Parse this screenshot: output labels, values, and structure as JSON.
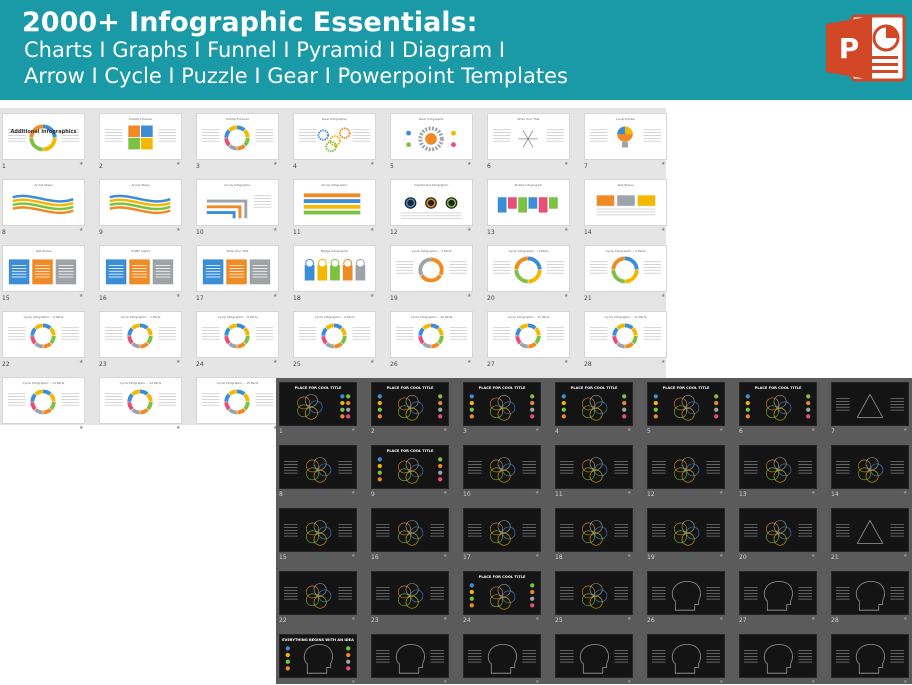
{
  "header": {
    "title": "2000+ Infographic Essentials:",
    "subtitle_line1": "Charts I Graphs I Funnel I Pyramid I Diagram I",
    "subtitle_line2": "Arrow I Cycle I Puzzle I Gear I Powerpoint Templates",
    "logo_icon": "powerpoint-logo-icon",
    "logo_letter": "P"
  },
  "colors": {
    "banner": "#1a9aa6",
    "powerpoint_orange": "#d24726",
    "light_panel": "#e5e5e5",
    "dark_panel": "#5b5b5b",
    "dark_slide": "#141414",
    "accent_blue": "#3b8ed6",
    "accent_yellow": "#f5b800",
    "accent_green": "#7cc242",
    "accent_orange": "#f08a24",
    "accent_gray": "#9ea3a8",
    "accent_pink": "#e94e77"
  },
  "light_panel": {
    "slides": [
      {
        "num": "1",
        "title": "",
        "text": "Additional Infographics",
        "art": "ring-multi"
      },
      {
        "num": "2",
        "title": "Puzzle 4 Pieces",
        "art": "puzzle"
      },
      {
        "num": "3",
        "title": "Puzzle 8 Pieces",
        "art": "ring-segments"
      },
      {
        "num": "4",
        "title": "Gear Infographic",
        "art": "gears"
      },
      {
        "num": "5",
        "title": "Gear Infographic",
        "art": "big-gear"
      },
      {
        "num": "6",
        "title": "Slide Your Title",
        "art": "asterisk"
      },
      {
        "num": "7",
        "title": "Lamp Puzzle",
        "art": "bulb"
      },
      {
        "num": "8",
        "title": "Arrow Steps",
        "art": "wave"
      },
      {
        "num": "9",
        "title": "Arrow Steps",
        "art": "wave"
      },
      {
        "num": "10",
        "title": "Arrow Infographic",
        "art": "pipes"
      },
      {
        "num": "11",
        "title": "Arrow Infographic",
        "art": "arrows"
      },
      {
        "num": "12",
        "title": "Dashboard Infographic",
        "art": "dials"
      },
      {
        "num": "13",
        "title": "Puzzle Infographic",
        "art": "puzzle-row"
      },
      {
        "num": "14",
        "title": "Text Boxes",
        "art": "text-boxes"
      },
      {
        "num": "15",
        "title": "Text Boxes",
        "art": "text-columns"
      },
      {
        "num": "16",
        "title": "Traffic Lights",
        "art": "text-columns"
      },
      {
        "num": "17",
        "title": "Slide Your Title",
        "art": "text-columns"
      },
      {
        "num": "18",
        "title": "Badge Infographic",
        "art": "badges"
      },
      {
        "num": "19",
        "title": "Cycle Infographic – 3 Parts",
        "art": "ring-orange"
      },
      {
        "num": "20",
        "title": "Cycle Infographic – 4 Parts",
        "art": "ring-multi"
      },
      {
        "num": "21",
        "title": "Cycle Infographic – 5 Parts",
        "art": "ring-multi"
      },
      {
        "num": "22",
        "title": "Cycle Infographic – 6 Parts",
        "art": "ring-segments"
      },
      {
        "num": "23",
        "title": "Cycle Infographic – 7 Parts",
        "art": "ring-segments"
      },
      {
        "num": "24",
        "title": "Cycle Infographic – 8 Parts",
        "art": "ring-segments"
      },
      {
        "num": "25",
        "title": "Cycle Infographic – 9 Parts",
        "art": "ring-segments"
      },
      {
        "num": "26",
        "title": "Cycle Infographic – 10 Parts",
        "art": "ring-segments"
      },
      {
        "num": "27",
        "title": "Cycle Infographic – 11 Parts",
        "art": "ring-segments"
      },
      {
        "num": "28",
        "title": "Cycle Infographic – 12 Parts",
        "art": "ring-segments"
      },
      {
        "num": "",
        "title": "Cycle Infographic – 13 Parts",
        "art": "ring-segments"
      },
      {
        "num": "",
        "title": "Cycle Infographic – 14 Parts",
        "art": "ring-segments"
      },
      {
        "num": "",
        "title": "Cycle Infographic – 15 Parts",
        "art": "ring-segments"
      }
    ]
  },
  "dark_panel": {
    "slides": [
      {
        "num": "1",
        "title": "PLACE FOR COOL TITLE",
        "art": "dark-flower-labeled"
      },
      {
        "num": "2",
        "title": "PLACE FOR COOL TITLE",
        "art": "dark-dots-flower"
      },
      {
        "num": "3",
        "title": "PLACE FOR COOL TITLE",
        "art": "dark-dots-flower"
      },
      {
        "num": "4",
        "title": "PLACE FOR COOL TITLE",
        "art": "dark-dots-flower"
      },
      {
        "num": "5",
        "title": "PLACE FOR COOL TITLE",
        "art": "dark-dots-flower"
      },
      {
        "num": "6",
        "title": "PLACE FOR COOL TITLE",
        "art": "dark-dots-flower"
      },
      {
        "num": "7",
        "title": "",
        "art": "dark-triangle"
      },
      {
        "num": "8",
        "title": "",
        "art": "dark-flower"
      },
      {
        "num": "9",
        "title": "PLACE FOR COOL TITLE",
        "art": "dark-dots-flower"
      },
      {
        "num": "10",
        "title": "",
        "art": "dark-flower"
      },
      {
        "num": "11",
        "title": "",
        "art": "dark-flower"
      },
      {
        "num": "12",
        "title": "",
        "art": "dark-flower"
      },
      {
        "num": "13",
        "title": "",
        "art": "dark-flower"
      },
      {
        "num": "14",
        "title": "",
        "art": "dark-flower"
      },
      {
        "num": "15",
        "title": "",
        "art": "dark-flower"
      },
      {
        "num": "16",
        "title": "",
        "art": "dark-flower"
      },
      {
        "num": "17",
        "title": "",
        "art": "dark-flower"
      },
      {
        "num": "18",
        "title": "",
        "art": "dark-flower"
      },
      {
        "num": "19",
        "title": "",
        "art": "dark-flower"
      },
      {
        "num": "20",
        "title": "",
        "art": "dark-flower"
      },
      {
        "num": "21",
        "title": "",
        "art": "dark-triangle"
      },
      {
        "num": "22",
        "title": "",
        "art": "dark-flower"
      },
      {
        "num": "23",
        "title": "",
        "art": "dark-flower"
      },
      {
        "num": "24",
        "title": "PLACE FOR COOL TITLE",
        "art": "dark-dots-flower"
      },
      {
        "num": "25",
        "title": "",
        "art": "dark-flower"
      },
      {
        "num": "26",
        "title": "",
        "art": "dark-head"
      },
      {
        "num": "27",
        "title": "",
        "art": "dark-head"
      },
      {
        "num": "28",
        "title": "",
        "art": "dark-head"
      },
      {
        "num": "",
        "title": "EVERYTHING BEGINS WITH AN IDEA",
        "art": "dark-dots-head"
      },
      {
        "num": "",
        "title": "",
        "art": "dark-head"
      },
      {
        "num": "",
        "title": "",
        "art": "dark-head"
      },
      {
        "num": "",
        "title": "",
        "art": "dark-head"
      },
      {
        "num": "",
        "title": "",
        "art": "dark-head"
      },
      {
        "num": "",
        "title": "",
        "art": "dark-head"
      },
      {
        "num": "",
        "title": "",
        "art": "dark-head"
      }
    ]
  }
}
